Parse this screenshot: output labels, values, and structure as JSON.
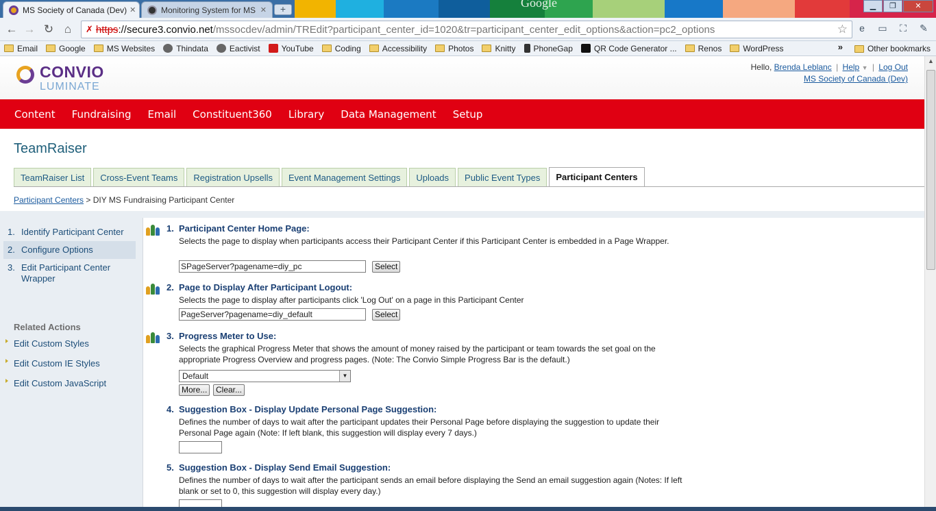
{
  "browser": {
    "tabs": [
      {
        "label": "MS Society of Canada (Dev)",
        "active": true
      },
      {
        "label": "Monitoring System for MS",
        "active": false
      }
    ],
    "google_text": "Google",
    "url": {
      "proto": "https",
      "host": "://secure3.convio.net",
      "path": "/mssocdev/admin/TREdit?participant_center_id=1020&tr=participant_center_edit_options&action=pc2_options"
    },
    "bookmarks": [
      {
        "label": "Email",
        "icon": "folder-icon"
      },
      {
        "label": "Google",
        "icon": "folder-icon"
      },
      {
        "label": "MS Websites",
        "icon": "folder-icon"
      },
      {
        "label": "Thindata",
        "icon": "globe-icon"
      },
      {
        "label": "Eactivist",
        "icon": "globe-icon"
      },
      {
        "label": "YouTube",
        "icon": "youtube-icon"
      },
      {
        "label": "Coding",
        "icon": "folder-icon"
      },
      {
        "label": "Accessibility",
        "icon": "folder-icon"
      },
      {
        "label": "Photos",
        "icon": "folder-icon"
      },
      {
        "label": "Knitty",
        "icon": "folder-icon"
      },
      {
        "label": "PhoneGap",
        "icon": "phone-icon"
      },
      {
        "label": "QR Code Generator ...",
        "icon": "qr-icon"
      },
      {
        "label": "Renos",
        "icon": "folder-icon"
      },
      {
        "label": "WordPress",
        "icon": "folder-icon"
      }
    ],
    "bookmarks_overflow": "»",
    "other_bookmarks": "Other bookmarks"
  },
  "header": {
    "logo_top": "CONVIO",
    "logo_bottom": "LUMINATE",
    "hello": "Hello,",
    "user_name": "Brenda Leblanc",
    "help": "Help",
    "logout": "Log Out",
    "org": "MS Society of Canada (Dev)"
  },
  "main_nav": [
    "Content",
    "Fundraising",
    "Email",
    "Constituent360",
    "Library",
    "Data Management",
    "Setup"
  ],
  "app_title": "TeamRaiser",
  "sub_tabs": [
    {
      "label": "TeamRaiser List",
      "current": false
    },
    {
      "label": "Cross-Event Teams",
      "current": false
    },
    {
      "label": "Registration Upsells",
      "current": false
    },
    {
      "label": "Event Management Settings",
      "current": false
    },
    {
      "label": "Uploads",
      "current": false
    },
    {
      "label": "Public Event Types",
      "current": false
    },
    {
      "label": "Participant Centers",
      "current": true
    }
  ],
  "breadcrumb": {
    "link": "Participant Centers",
    "separator": ">",
    "current": "DIY MS Fundraising Participant Center"
  },
  "steps": [
    {
      "num": "1.",
      "label": "Identify Participant Center"
    },
    {
      "num": "2.",
      "label": "Configure Options"
    },
    {
      "num": "3.",
      "label": "Edit Participant Center Wrapper"
    }
  ],
  "related": {
    "title": "Related Actions",
    "items": [
      "Edit Custom Styles",
      "Edit Custom IE Styles",
      "Edit Custom JavaScript"
    ]
  },
  "fields": {
    "f1": {
      "num": "1.",
      "title": "Participant Center Home Page:",
      "desc": "Selects the page to display when participants access their Participant Center if this Participant Center is embedded in a Page Wrapper.",
      "value": "SPageServer?pagename=diy_pc",
      "button": "Select"
    },
    "f2": {
      "num": "2.",
      "title": "Page to Display After Participant Logout:",
      "desc": "Selects the page to display after participants click 'Log Out' on a page in this Participant Center",
      "value": "PageServer?pagename=diy_default",
      "button": "Select"
    },
    "f3": {
      "num": "3.",
      "title": "Progress Meter to Use:",
      "desc": "Selects the graphical Progress Meter that shows the amount of money raised by the participant or team towards the set goal on the appropriate Progress Overview and progress pages. (Note: The Convio Simple Progress Bar is the default.)",
      "selected": "Default",
      "more": "More...",
      "clear": "Clear..."
    },
    "f4": {
      "num": "4.",
      "title": "Suggestion Box - Display Update Personal Page Suggestion:",
      "desc": "Defines the number of days to wait after the participant updates their Personal Page before displaying the suggestion to update their Personal Page again (Note: If left blank, this suggestion will display every 7 days.)",
      "value": ""
    },
    "f5": {
      "num": "5.",
      "title": "Suggestion Box - Display Send Email Suggestion:",
      "desc": "Defines the number of days to wait after the participant sends an email before displaying the Send an email suggestion again (Notes: If left blank or set to 0, this suggestion will display every day.)",
      "value": ""
    }
  },
  "colors": {
    "nav_red": "#e00012",
    "link_blue": "#1a5a9e",
    "heading_blue": "#1a3f73"
  }
}
